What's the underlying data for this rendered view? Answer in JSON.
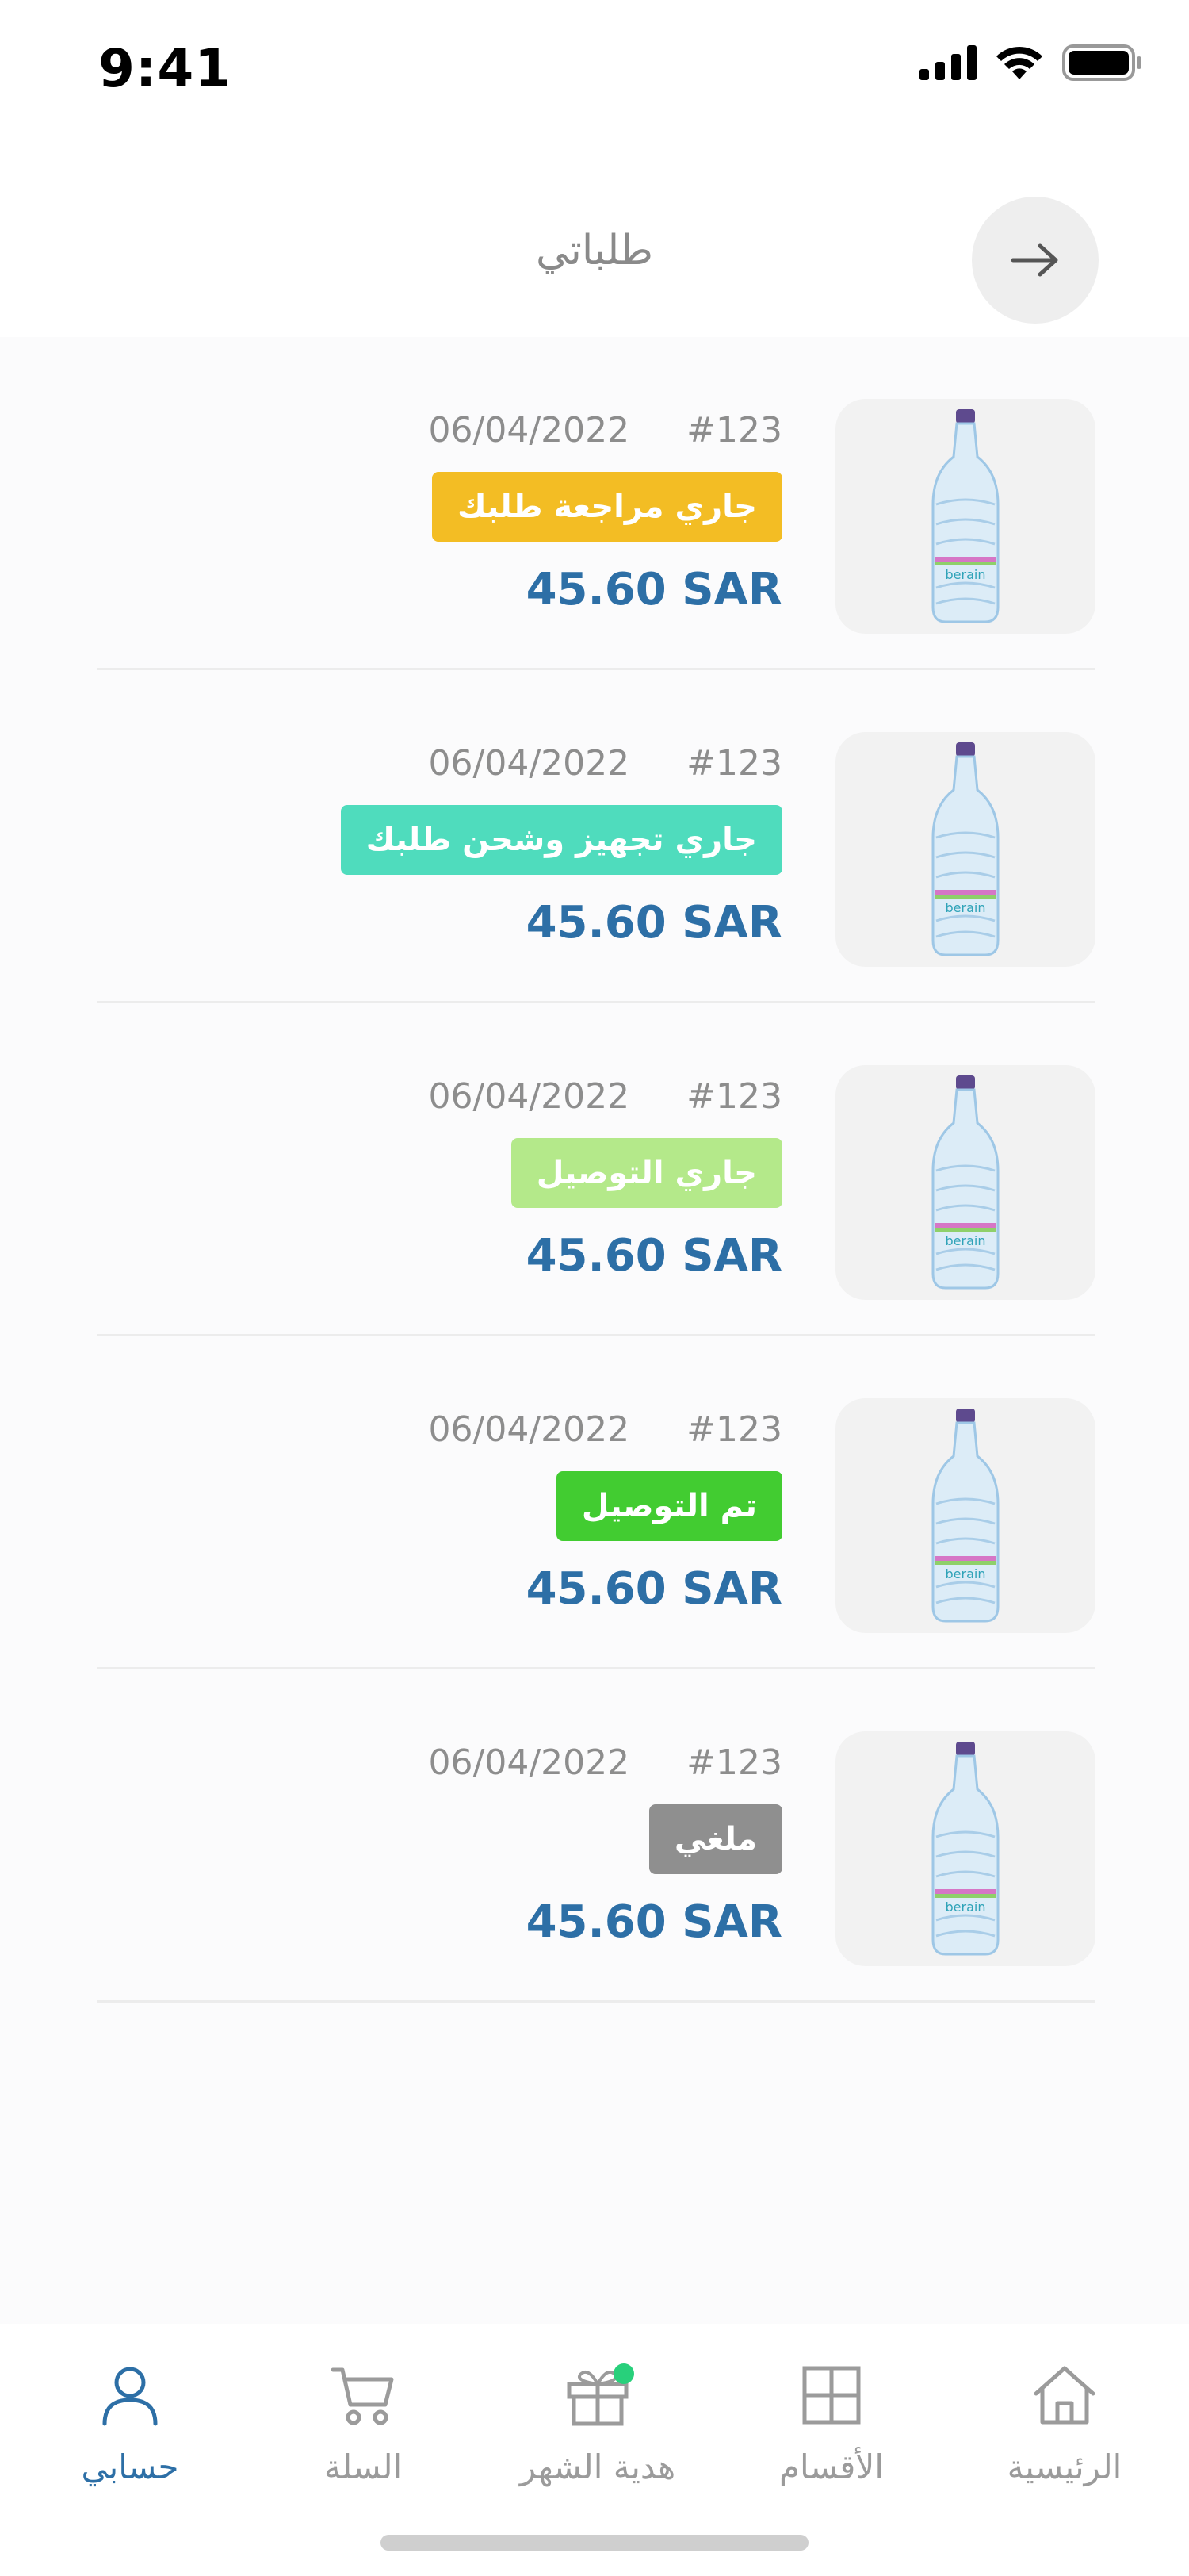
{
  "status_bar": {
    "time": "9:41"
  },
  "header": {
    "title": "طلباتي"
  },
  "orders": [
    {
      "order_number": "#123",
      "date": "06/04/2022",
      "status": "جاري مراجعة طلبك",
      "status_color": "#f3bd24",
      "price": "45.60 SAR"
    },
    {
      "order_number": "#123",
      "date": "06/04/2022",
      "status": "جاري تجهيز وشحن طلبك",
      "status_color": "#4fdcbd",
      "price": "45.60 SAR"
    },
    {
      "order_number": "#123",
      "date": "06/04/2022",
      "status": "جاري التوصيل",
      "status_color": "#b4e98a",
      "price": "45.60 SAR"
    },
    {
      "order_number": "#123",
      "date": "06/04/2022",
      "status": "تم التوصيل",
      "status_color": "#42cc31",
      "price": "45.60 SAR"
    },
    {
      "order_number": "#123",
      "date": "06/04/2022",
      "status": "ملغي",
      "status_color": "#8f8f8f",
      "price": "45.60 SAR"
    }
  ],
  "bottom_nav": {
    "home": "الرئيسية",
    "categories": "الأقسام",
    "gift": "هدية الشهر",
    "cart": "السلة",
    "account": "حسابي",
    "active": "account"
  },
  "colors": {
    "accent": "#2d6fa6",
    "inactive": "#9b9b9b",
    "notification_dot": "#28d07b"
  }
}
